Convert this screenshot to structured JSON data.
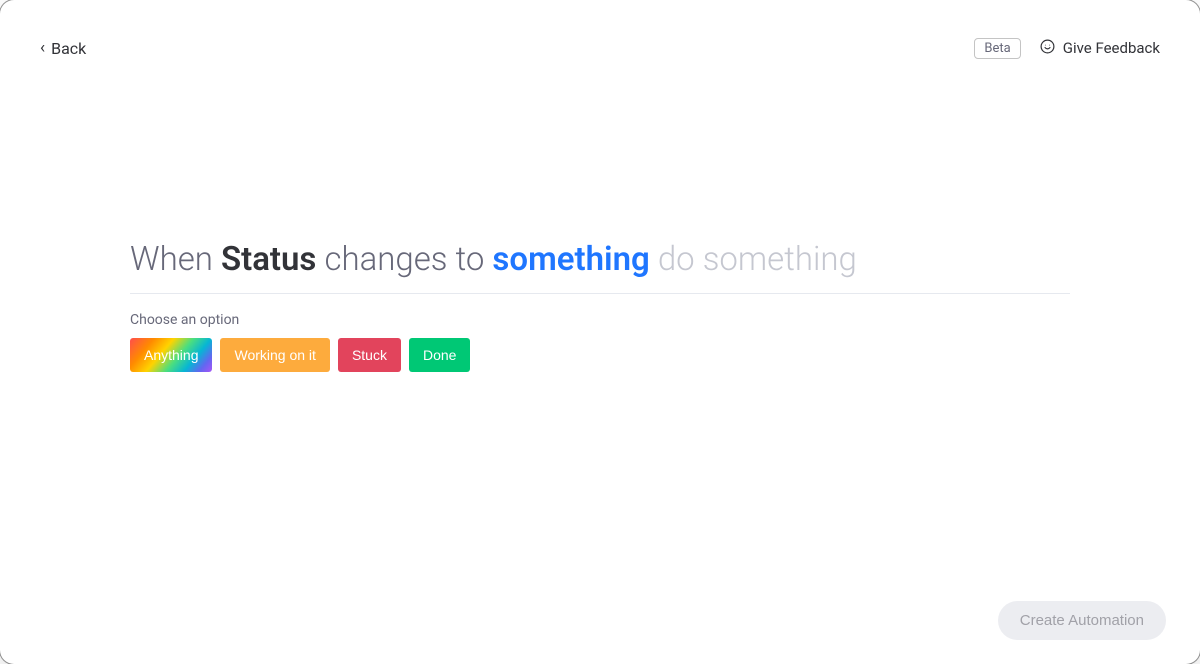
{
  "header": {
    "back_label": "Back",
    "beta_label": "Beta",
    "feedback_label": "Give Feedback"
  },
  "sentence": {
    "part1": "When ",
    "column": "Status",
    "part2": " changes to ",
    "value_token": "something",
    "part3": " do something"
  },
  "choose_label": "Choose an option",
  "options": [
    {
      "key": "anything",
      "label": "Anything"
    },
    {
      "key": "working",
      "label": "Working on it"
    },
    {
      "key": "stuck",
      "label": "Stuck"
    },
    {
      "key": "done",
      "label": "Done"
    }
  ],
  "footer": {
    "create_label": "Create Automation"
  }
}
